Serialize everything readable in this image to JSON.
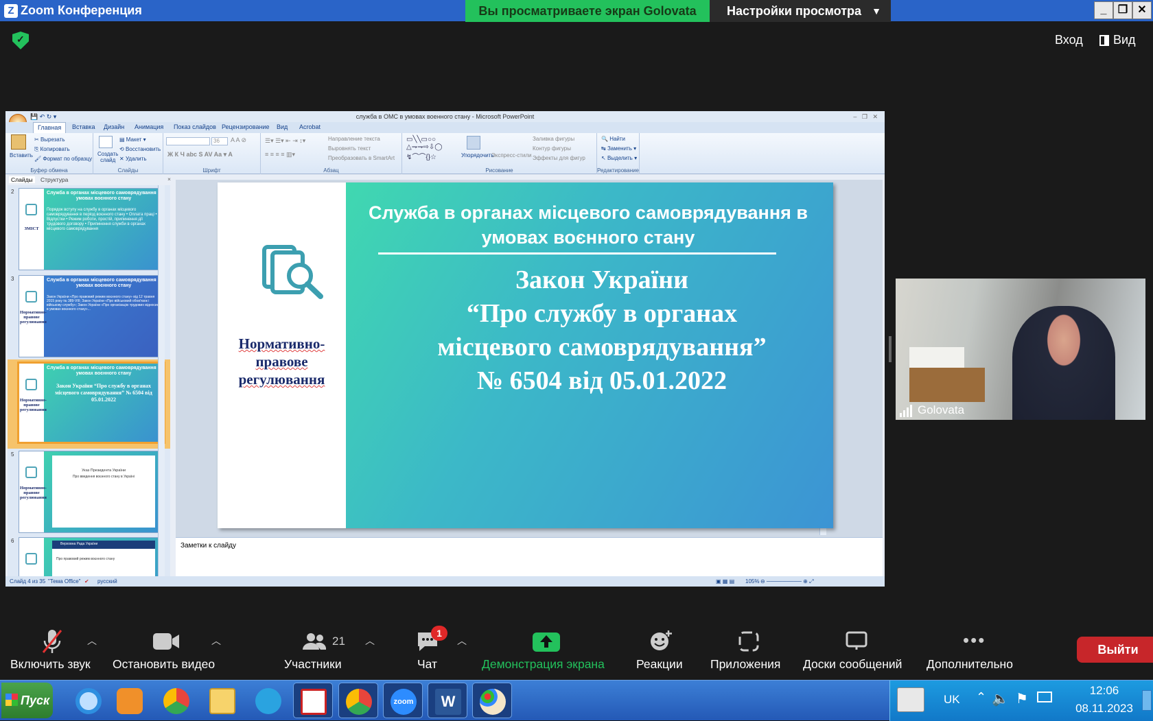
{
  "zoom": {
    "window_title": "Zoom Конференция",
    "share_banner": "Вы просматриваете экран Golovata",
    "view_options": "Настройки просмотра",
    "enter_label": "Вход",
    "view_label": "Вид",
    "participant_name": "Golovata",
    "controls": {
      "audio": "Включить звук",
      "video": "Остановить видео",
      "participants": "Участники",
      "participants_count": "21",
      "chat": "Чат",
      "chat_badge": "1",
      "share": "Демонстрация экрана",
      "reactions": "Реакции",
      "apps": "Приложения",
      "whiteboards": "Доски сообщений",
      "more": "Дополнительно",
      "leave": "Выйти"
    }
  },
  "ppt": {
    "title": "служба в ОМС в умовах военного стану - Microsoft PowerPoint",
    "tabs": [
      "Главная",
      "Вставка",
      "Дизайн",
      "Анимация",
      "Показ слайдов",
      "Рецензирование",
      "Вид",
      "Acrobat"
    ],
    "ribbon": {
      "clipboard": {
        "label": "Буфер обмена",
        "paste": "Вставить",
        "cut": "Вырезать",
        "copy": "Копировать",
        "format": "Формат по образцу"
      },
      "slides": {
        "label": "Слайды",
        "create": "Создать",
        "create2": "слайд",
        "layout": "Макет",
        "reset": "Восстановить",
        "delete": "Удалить"
      },
      "font": {
        "label": "Шрифт",
        "size": "36"
      },
      "paragraph": {
        "label": "Абзац",
        "direction": "Направление текста",
        "align": "Выровнять текст",
        "smartart": "Преобразовать в SmartArt"
      },
      "drawing": {
        "label": "Рисование",
        "arrange": "Упорядочить",
        "styles": "Экспресс-стили",
        "fill": "Заливка фигуры",
        "outline": "Контур фигуры",
        "effects": "Эффекты для фигур"
      },
      "editing": {
        "label": "Редактирование",
        "find": "Найти",
        "replace": "Заменить",
        "select": "Выделить"
      }
    },
    "panel_tabs": {
      "slides": "Слайды",
      "outline": "Структура"
    },
    "thumbs": [
      {
        "num": "2",
        "title": "Служба в органах місцевого самоврядування в умовах воєнного стану",
        "side": "ЗМІСТ",
        "text": "Порядок вступу на службу в органах місцевого самоврядування в період воєнного стану • Оплата праці • Відпустки • Режим роботи, простій, припинення дії трудового договору • Припинення служби в органах місцевого самоврядування"
      },
      {
        "num": "3",
        "title": "Служба в органах місцевого самоврядування в умовах воєнного стану",
        "side": "Нормативно-правове регулювання",
        "text": "Закон України «Про правовий режим воєнного стану» від 12 травня 2015 року № 389-VIII; Закон України «Про військовий обов'язок і військову службу»; Закон України «Про організацію трудових відносин в умовах воєнного стану»..."
      },
      {
        "num": "4",
        "title": "Служба в органах місцевого самоврядування в умовах воєнного стану",
        "side": "Нормативно-правове регулювання",
        "text": "Закон України “Про службу в органах місцевого самоврядування” № 6504 від 05.01.2022"
      },
      {
        "num": "5",
        "title": "Указ Президента України",
        "side": "Нормативно-правове регулювання",
        "text": "Про введення воєнного стану в Україні"
      },
      {
        "num": "6",
        "title": "Верховна Рада України",
        "side": "",
        "text": "Про правовий режим воєнного стану"
      }
    ],
    "slide": {
      "header": "Служба в органах місцевого самоврядування в умовах воєнного стану",
      "law_l1": "Закон України",
      "law_l2": "“Про службу в органах",
      "law_l3": "місцевого самоврядування”",
      "law_l4": "№ 6504 від 05.01.2022",
      "side": "Нормативно-правове регулювання"
    },
    "notes": "Заметки к слайду",
    "status": {
      "slide": "Слайд 4 из 35",
      "theme": "\"Тема Office\"",
      "lang": "русский",
      "zoom": "105%"
    }
  },
  "taskbar": {
    "start": "Пуск",
    "lang": "UK",
    "time": "12:06",
    "date": "08.11.2023",
    "apps": [
      "internet-explorer",
      "media-player",
      "chrome",
      "file-explorer",
      "telegram",
      "pdf-reader",
      "chrome-profile",
      "zoom",
      "word",
      "paint"
    ]
  },
  "colors": {
    "zoom_green": "#23c15c",
    "leave_red": "#c7262a",
    "slide_teal": "#40d8b0",
    "slide_blue": "#3c94d4"
  }
}
